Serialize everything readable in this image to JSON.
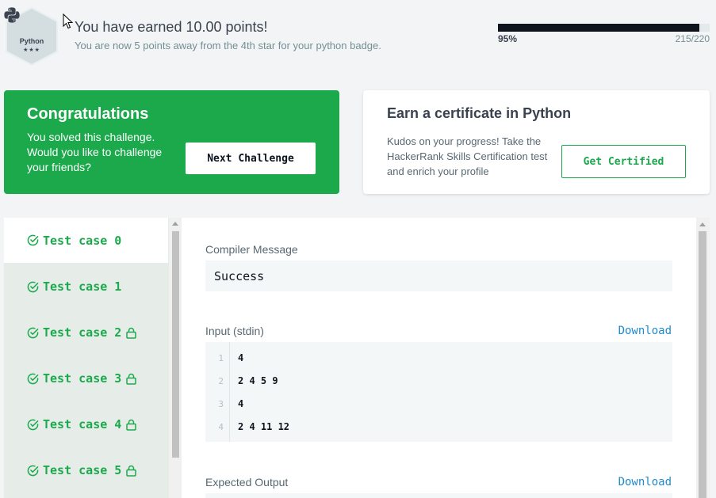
{
  "header": {
    "badge": {
      "name": "Python",
      "stars": "★★★",
      "icon": "python-logo-icon",
      "color": "#d4dde0"
    },
    "title": "You have earned 10.00 points!",
    "subtitle": "You are now 5 points away from the 4th star for your python badge.",
    "progress": {
      "fraction": 0.95,
      "percent_label": "95%",
      "count_label": "215/220"
    }
  },
  "congrats_card": {
    "title": "Congratulations",
    "description": "You solved this challenge. Would you like to challenge your friends?",
    "button_label": "Next Challenge",
    "color": "#1ba94c"
  },
  "cert_card": {
    "title": "Earn a certificate in Python",
    "description": "Kudos on your progress! Take the HackerRank Skills Certification test and enrich your profile",
    "button_label": "Get Certified"
  },
  "test_cases": [
    {
      "label": "Test case 0",
      "locked": false,
      "active": true
    },
    {
      "label": "Test case 1",
      "locked": false,
      "active": false
    },
    {
      "label": "Test case 2",
      "locked": true,
      "active": false
    },
    {
      "label": "Test case 3",
      "locked": true,
      "active": false
    },
    {
      "label": "Test case 4",
      "locked": true,
      "active": false
    },
    {
      "label": "Test case 5",
      "locked": true,
      "active": false
    }
  ],
  "result": {
    "compiler_label": "Compiler Message",
    "compiler_message": "Success",
    "input_label": "Input (stdin)",
    "download_label": "Download",
    "input_lines": [
      {
        "num": "1",
        "text": "4"
      },
      {
        "num": "2",
        "text": "2 4 5 9"
      },
      {
        "num": "3",
        "text": "4"
      },
      {
        "num": "4",
        "text": "2 4 11 12"
      }
    ],
    "expected_label": "Expected Output",
    "expected_download_label": "Download"
  },
  "colors": {
    "success": "#1ba94c",
    "link": "#1f8acb",
    "dark": "#0e141e",
    "background": "#f2f4f5"
  }
}
